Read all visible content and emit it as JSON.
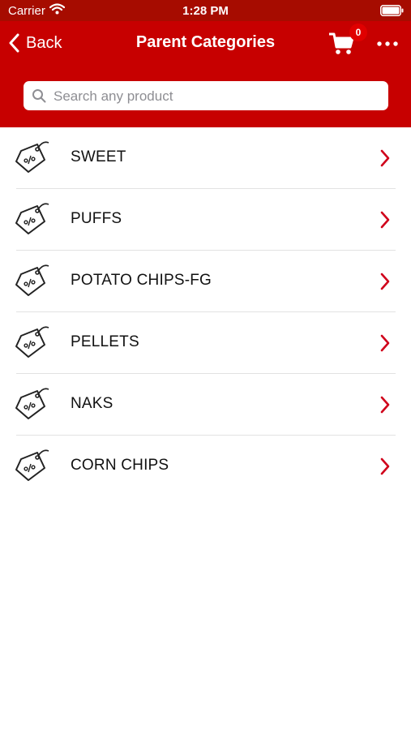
{
  "status": {
    "carrier": "Carrier",
    "time": "1:28 PM"
  },
  "nav": {
    "back_label": "Back",
    "title": "Parent Categories",
    "cart_count": "0"
  },
  "search": {
    "placeholder": "Search any product"
  },
  "categories": [
    {
      "label": "SWEET"
    },
    {
      "label": "PUFFS"
    },
    {
      "label": "POTATO CHIPS-FG"
    },
    {
      "label": "PELLETS"
    },
    {
      "label": "NAKS"
    },
    {
      "label": "CORN CHIPS"
    }
  ],
  "colors": {
    "brand": "#c70000",
    "status_bar": "#a60c00",
    "chevron": "#d0021b",
    "badge": "#e00000"
  },
  "icons": {
    "row": "price-tag-icon",
    "chevron": "chevron-right-icon"
  }
}
